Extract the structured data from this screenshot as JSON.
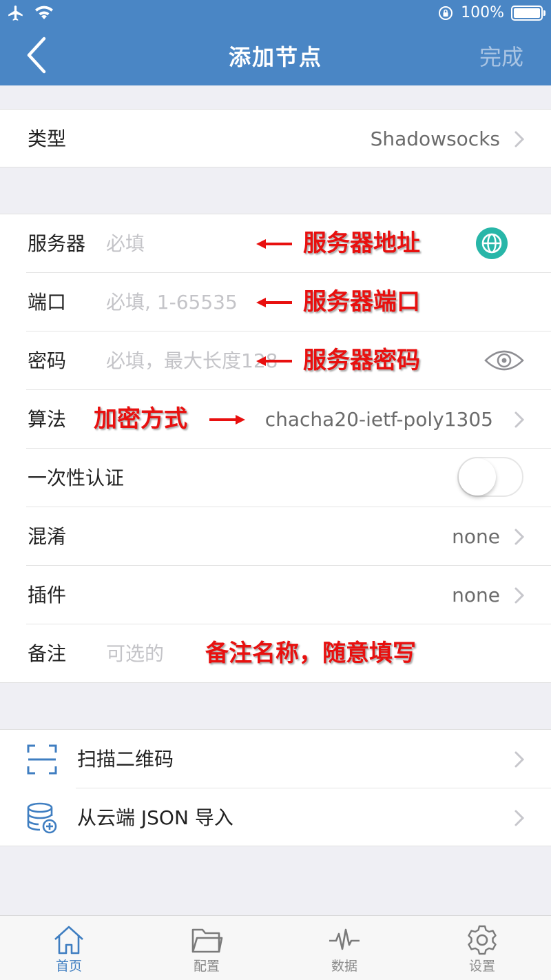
{
  "status_bar": {
    "battery": "100%"
  },
  "nav": {
    "title": "添加节点",
    "done_label": "完成"
  },
  "type_row": {
    "label": "类型",
    "value": "Shadowsocks"
  },
  "form": {
    "server": {
      "label": "服务器",
      "placeholder": "必填",
      "annotation": "服务器地址"
    },
    "port": {
      "label": "端口",
      "placeholder": "必填, 1-65535",
      "annotation": "服务器端口"
    },
    "password": {
      "label": "密码",
      "placeholder": "必填，最大长度128",
      "annotation": "服务器密码"
    },
    "cipher": {
      "label": "算法",
      "annotation": "加密方式",
      "value": "chacha20-ietf-poly1305"
    },
    "ota": {
      "label": "一次性认证",
      "enabled": false
    },
    "obfs": {
      "label": "混淆",
      "value": "none"
    },
    "plugin": {
      "label": "插件",
      "value": "none"
    },
    "remark": {
      "label": "备注",
      "placeholder": "可选的",
      "annotation": "备注名称，随意填写"
    }
  },
  "actions": [
    {
      "label": "扫描二维码",
      "icon": "qr-scan-icon"
    },
    {
      "label": "从云端 JSON 导入",
      "icon": "cloud-database-icon"
    }
  ],
  "tabs": [
    {
      "label": "首页",
      "icon": "home-icon",
      "active": true
    },
    {
      "label": "配置",
      "icon": "folder-icon",
      "active": false
    },
    {
      "label": "数据",
      "icon": "pulse-icon",
      "active": false
    },
    {
      "label": "设置",
      "icon": "gear-icon",
      "active": false
    }
  ],
  "colors": {
    "header": "#4a86c5",
    "annotation": "#e8100f",
    "globe": "#28b6a8",
    "active_tab": "#3f7ec1"
  }
}
